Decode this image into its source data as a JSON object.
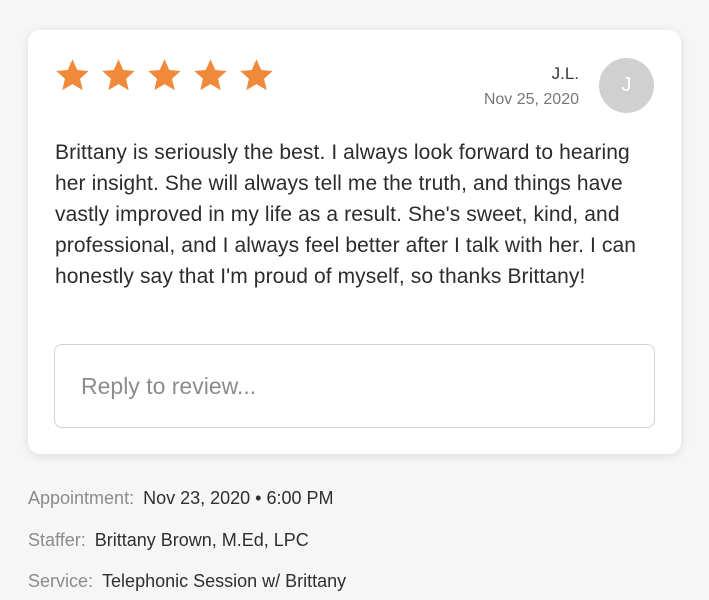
{
  "review": {
    "rating": 5,
    "star_color": "#f0893a",
    "reviewer_initials": "J.L.",
    "date": "Nov 25, 2020",
    "avatar_letter": "J",
    "text": "Brittany is seriously the best. I always look forward to hearing her insight. She will always tell me the truth, and things have vastly improved in my life as a result. She's sweet, kind, and professional, and I always feel better after I talk with her. I can honestly say that I'm proud of myself, so thanks Brittany!",
    "reply_placeholder": "Reply to review..."
  },
  "details": {
    "appointment": {
      "label": "Appointment:",
      "value": "Nov 23, 2020 • 6:00 PM"
    },
    "staffer": {
      "label": "Staffer:",
      "value": "Brittany Brown, M.Ed, LPC"
    },
    "service": {
      "label": "Service:",
      "value": "Telephonic Session w/ Brittany"
    }
  }
}
